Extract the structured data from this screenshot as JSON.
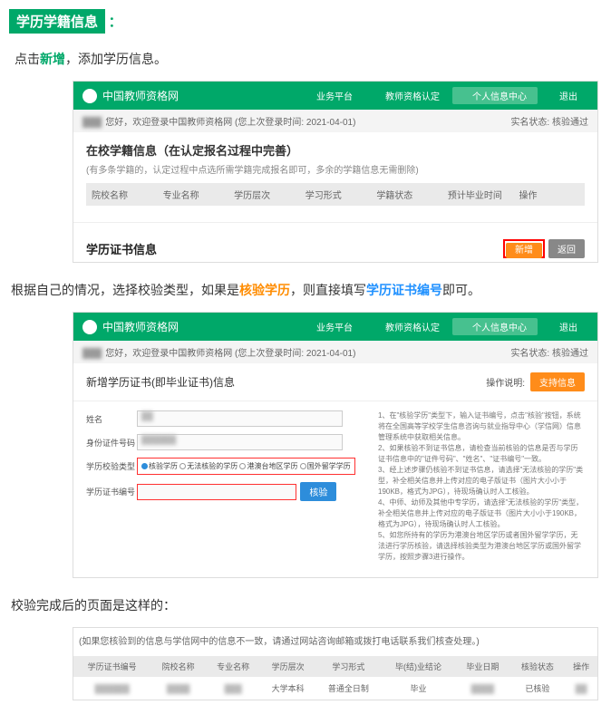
{
  "heading": "学历学籍信息",
  "heading_colon": "：",
  "instr1_pre": "点击",
  "instr1_hl": "新增",
  "instr1_post": "，添加学历信息。",
  "instr2_pre": "根据自己的情况，选择校验类型，如果是",
  "instr2_hl1": "核验学历",
  "instr2_mid": "，则直接填写",
  "instr2_hl2": "学历证书编号",
  "instr2_post": "即可。",
  "instr3": "校验完成后的页面是这样的：",
  "brand": "中国教师资格网",
  "nav": {
    "n1": "业务平台",
    "n2": "教师资格认定",
    "n3": "个人信息中心",
    "n4": "退出"
  },
  "welcome": "您好，欢迎登录中国教师资格网 (您上次登录时间: 2021-04-01)",
  "realname_lbl": "实名状态:",
  "realname_val": "核验通过",
  "sec1_title": "在校学籍信息（在认定报名过程中完善）",
  "sec1_sub": "(有多条学籍的，认定过程中点选所需学籍完成报名即可，多余的学籍信息无需删除)",
  "cols": {
    "c1": "院校名称",
    "c2": "专业名称",
    "c3": "学历层次",
    "c4": "学习形式",
    "c5": "学籍状态",
    "c6": "预计毕业时间",
    "c7": "操作"
  },
  "sec2_title": "学历证书信息",
  "btn_add": "新增",
  "btn_ret": "返回",
  "panel2_title": "新增学历证书(即毕业证书)信息",
  "panel2_ophint": "操作说明:",
  "btn_guide": "支持信息",
  "form": {
    "f1": "姓名",
    "f2": "身份证件号码",
    "f3": "学历校验类型",
    "f4": "学历证书编号",
    "r1": "核验学历",
    "r2": "无法核验的学历",
    "r3": "港澳台地区学历",
    "r4": "国外留学学历",
    "btn_verify": "核验"
  },
  "info": {
    "l1": "1、在\"核验学历\"类型下，输入证书编号，点击\"核验\"按钮，系统将在全国高等学校学生信息咨询与就业指导中心（学信网）信息管理系统中获取相关信息。",
    "l2": "2、如果核验不到证书信息，请检查当前核验的信息是否与学历证书信息中的\"证件号码\"、\"姓名\"、\"证书编号\"一致。",
    "l3": "3、经上述步骤仍核验不到证书信息，请选择\"无法核验的学历\"类型，补全相关信息并上传对应的电子版证书（图片大小小于190KB，格式为JPG），待现场确认时人工核验。",
    "l4": "4、中师、幼师及其他中专学历，请选择\"无法核验的学历\"类型，补全相关信息并上传对应的电子版证书（图片大小小于190KB，格式为JPG），待现场确认时人工核验。",
    "l5": "5、如您所持有的学历为港澳台地区学历或者国外留学学历，无法进行学历核验，请选择核验类型为港澳台地区学历或国外留学学历，按照步骤3进行操作。"
  },
  "result_tip": "(如果您核验到的信息与学信网中的信息不一致，请通过网站咨询邮箱或拨打电话联系我们核查处理。)",
  "rcols": {
    "r1": "学历证书编号",
    "r2": "院校名称",
    "r3": "专业名称",
    "r4": "学历层次",
    "r5": "学习形式",
    "r6": "毕(结)业结论",
    "r7": "毕业日期",
    "r8": "核验状态",
    "r9": "操作"
  },
  "rvals": {
    "v4": "大学本科",
    "v5": "普通全日制",
    "v6": "毕业",
    "v8": "已核验"
  }
}
